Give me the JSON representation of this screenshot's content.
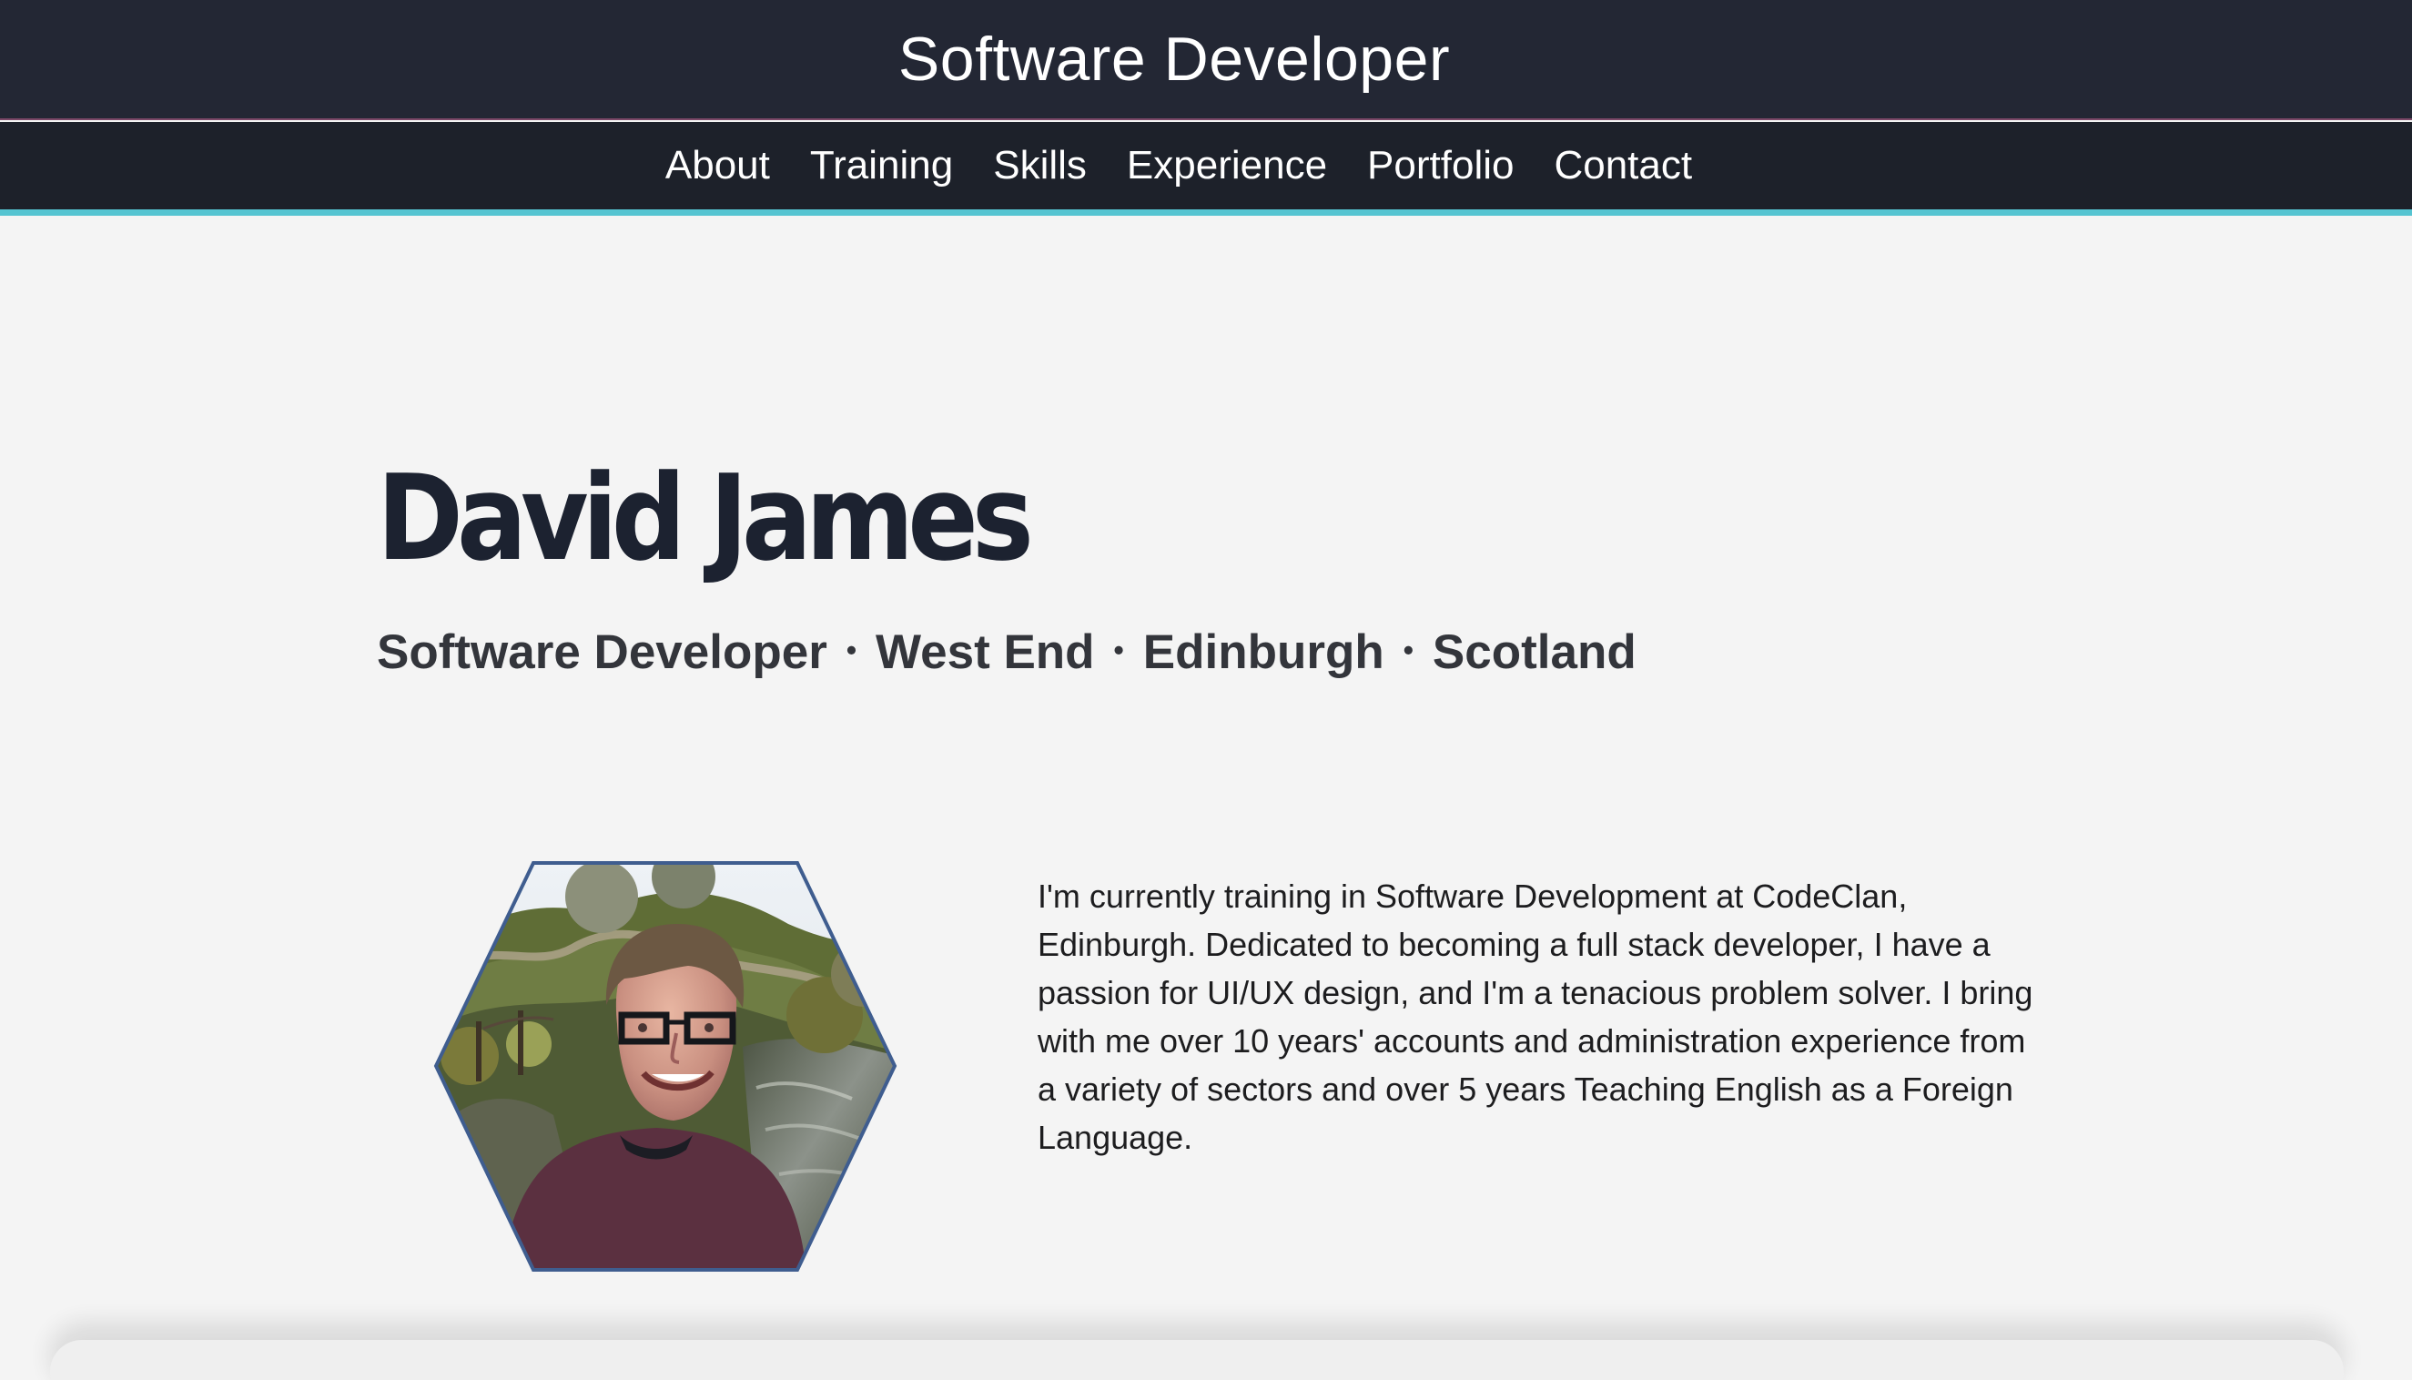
{
  "header": {
    "title": "Software Developer"
  },
  "nav": {
    "items": [
      {
        "label": "About"
      },
      {
        "label": "Training"
      },
      {
        "label": "Skills"
      },
      {
        "label": "Experience"
      },
      {
        "label": "Portfolio"
      },
      {
        "label": "Contact"
      }
    ]
  },
  "hero": {
    "name": "David  James",
    "subtitle_parts": [
      "Software Developer",
      "West End",
      "Edinburgh",
      "Scotland"
    ],
    "separator": "•"
  },
  "about": {
    "bio": "I'm currently training in Software Development at CodeClan, Edinburgh. Dedicated to becoming a full stack developer, I have a passion for UI/UX design, and I'm a tenacious problem solver. I bring with me over 10 years' accounts and administration experience from a variety of sectors and over 5 years Teaching English as a Foreign Language."
  },
  "colors": {
    "header_bg": "#232734",
    "nav_bg": "#1d212a",
    "accent": "#55c4d1",
    "page_bg": "#f4f4f4",
    "name": "#1c2230",
    "subtitle": "#33353b"
  }
}
